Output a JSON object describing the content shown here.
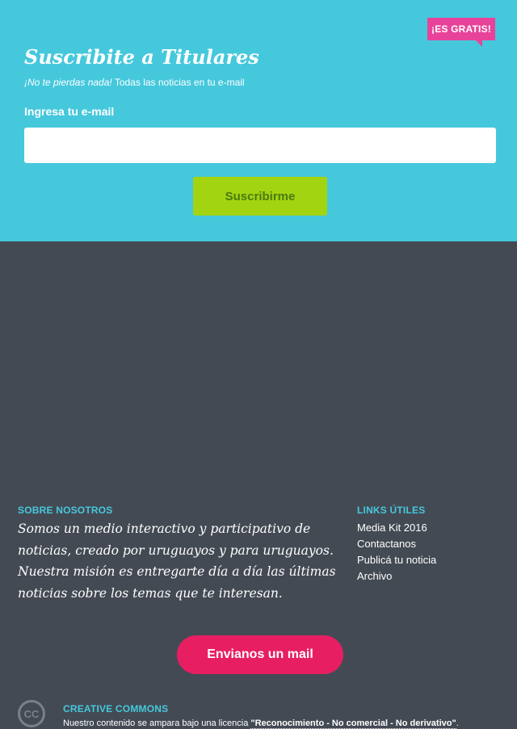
{
  "subscribe": {
    "badge": "¡ES GRATIS!",
    "title": "Suscribite a Titulares",
    "tagline_em": "¡No te pierdas nada!",
    "tagline_rest": " Todas las noticias en tu e-mail",
    "email_label": "Ingresa tu e-mail",
    "email_value": "",
    "email_placeholder": "",
    "button_label": "Suscribirme"
  },
  "about": {
    "heading": "SOBRE NOSOTROS",
    "text": "Somos un medio interactivo y participativo de noticias, creado por uruguayos y para uruguayos. Nuestra misión es entregarte día a día las últimas noticias sobre los temas que te interesan."
  },
  "links": {
    "heading": "LINKS ÚTILES",
    "items": [
      "Media Kit 2016",
      "Contactanos",
      "Publicá tu noticia",
      "Archivo"
    ]
  },
  "contact": {
    "button_label": "Envianos un mail"
  },
  "creative_commons": {
    "icon_label": "CC",
    "icon": "creative-commons-icon",
    "heading": "CREATIVE COMMONS",
    "text": "Nuestro contenido se ampara bajo una licencia ",
    "license_link": "\"Reconocimiento - No comercial - No derivativo\"",
    "text_end": "."
  },
  "colors": {
    "subscribe_bg": "#45c8dc",
    "footer_bg": "#444a54",
    "badge": "#e8439a",
    "subscribe_button": "#a3d411",
    "mail_button": "#e81e63",
    "heading_accent": "#45c8dc"
  }
}
